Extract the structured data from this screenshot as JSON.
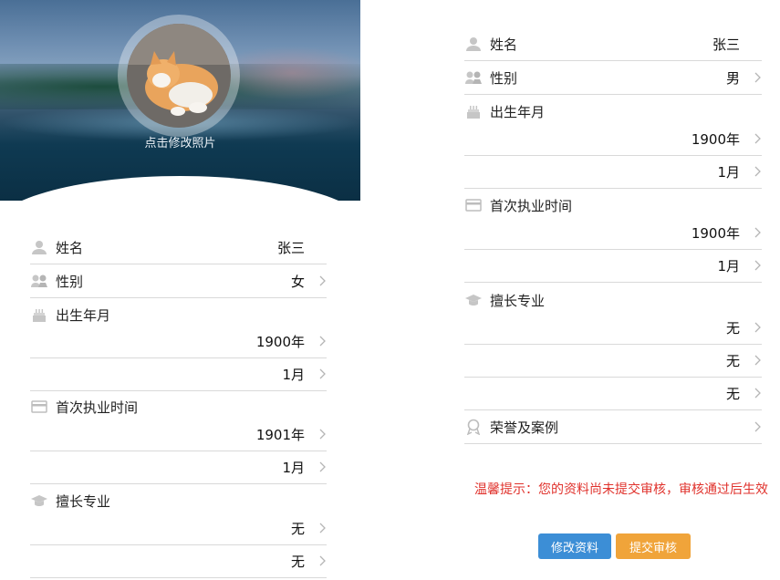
{
  "left": {
    "change_photo": "点击修改照片",
    "rows": [
      {
        "label": "姓名",
        "value": "张三",
        "icon": "person-icon"
      },
      {
        "label": "性别",
        "value": "女",
        "icon": "gender-icon"
      },
      {
        "label": "出生年月",
        "value": "",
        "icon": "cake-icon"
      },
      {
        "label": "",
        "value": "1900年"
      },
      {
        "label": "",
        "value": "1月"
      },
      {
        "label": "首次执业时间",
        "value": "",
        "icon": "card-icon"
      },
      {
        "label": "",
        "value": "1901年"
      },
      {
        "label": "",
        "value": "1月"
      },
      {
        "label": "擅长专业",
        "value": "",
        "icon": "graduation-cap-icon"
      },
      {
        "label": "",
        "value": "无"
      },
      {
        "label": "",
        "value": "无"
      }
    ]
  },
  "right": {
    "rows": [
      {
        "label": "姓名",
        "value": "张三",
        "icon": "person-icon"
      },
      {
        "label": "性别",
        "value": "男",
        "icon": "gender-icon"
      },
      {
        "label": "出生年月",
        "value": "",
        "icon": "cake-icon"
      },
      {
        "label": "",
        "value": "1900年"
      },
      {
        "label": "",
        "value": "1月"
      },
      {
        "label": "首次执业时间",
        "value": "",
        "icon": "card-icon"
      },
      {
        "label": "",
        "value": "1900年"
      },
      {
        "label": "",
        "value": "1月"
      },
      {
        "label": "擅长专业",
        "value": "",
        "icon": "graduation-cap-icon"
      },
      {
        "label": "",
        "value": "无"
      },
      {
        "label": "",
        "value": "无"
      },
      {
        "label": "",
        "value": "无"
      },
      {
        "label": "荣誉及案例",
        "value": "",
        "icon": "ribbon-icon"
      }
    ],
    "tip": "温馨提示：您的资料尚未提交审核，审核通过后生效",
    "edit_button": "修改资料",
    "submit_button": "提交审核"
  },
  "colors": {
    "tip": "#e0322c",
    "edit_button": "#3c8ed6",
    "submit_button": "#f0a43a"
  }
}
